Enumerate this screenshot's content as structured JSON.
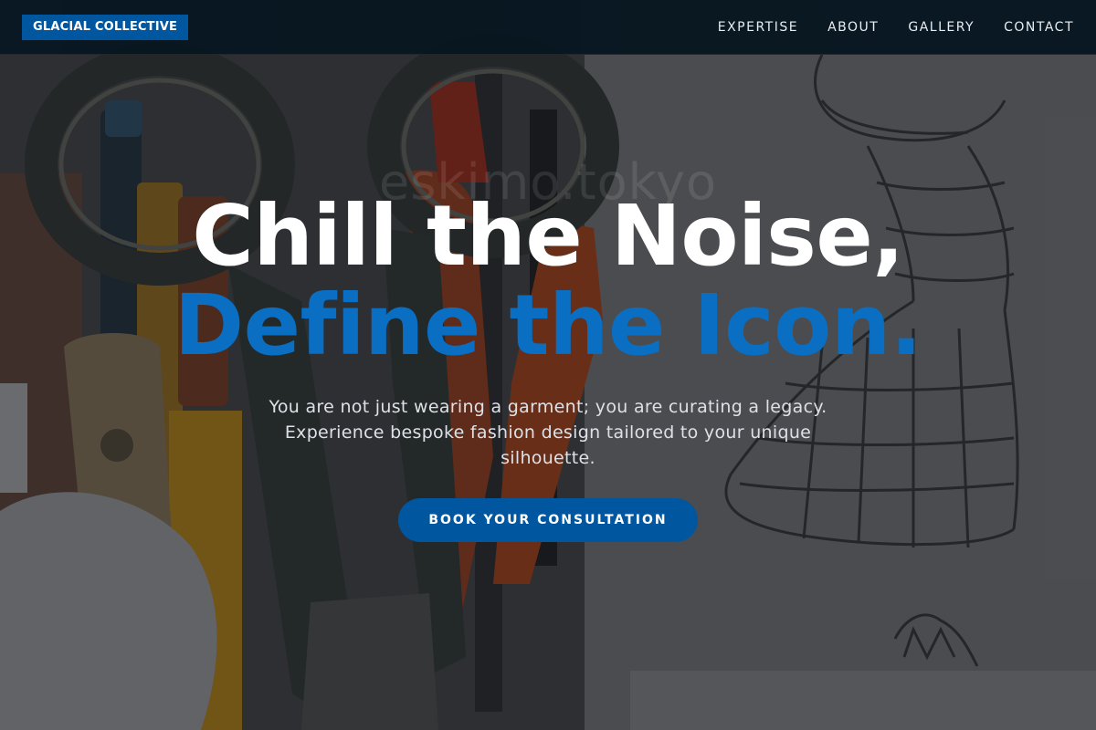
{
  "nav": {
    "logo": "GLACIAL COLLECTIVE",
    "links": [
      "EXPERTISE",
      "ABOUT",
      "GALLERY",
      "CONTACT"
    ]
  },
  "hero": {
    "headline_line1": "Chill the Noise,",
    "headline_line2": "Define the Icon.",
    "watermark": "eskimo.tokyo",
    "subtext": "You are not just wearing a garment; you are curating a legacy. Experience bespoke fashion design tailored to your unique silhouette.",
    "cta_label": "BOOK YOUR CONSULTATION"
  },
  "colors": {
    "accent": "#0057a0",
    "headline_accent": "#0a6fc2",
    "nav_bg": "#061620"
  }
}
